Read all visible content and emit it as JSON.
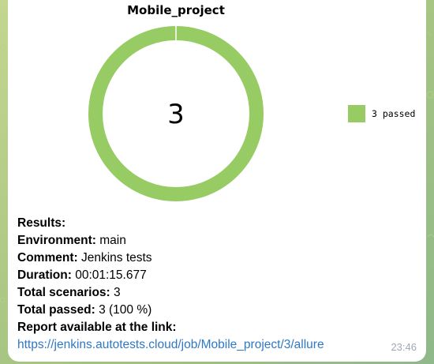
{
  "message": {
    "timestamp": "23:46",
    "results_heading": "Results:",
    "environment_label": "Environment:",
    "environment_value": "main",
    "comment_label": "Comment:",
    "comment_value": "Jenkins tests",
    "duration_label": "Duration:",
    "duration_value": "00:01:15.677",
    "total_scenarios_label": "Total scenarios:",
    "total_scenarios_value": "3",
    "total_passed_label": "Total passed:",
    "total_passed_value": "3 (100 %)",
    "report_label": "Report available at the link:",
    "report_link": "https://jenkins.autotests.cloud/job/Mobile_project/3/allure"
  },
  "chart_data": {
    "type": "pie",
    "title": "Mobile_project",
    "center_label": "3",
    "categories": [
      "passed"
    ],
    "values": [
      3
    ],
    "legend": [
      "3 passed"
    ],
    "legend_position": "right",
    "colors": [
      "#97cc64"
    ]
  }
}
